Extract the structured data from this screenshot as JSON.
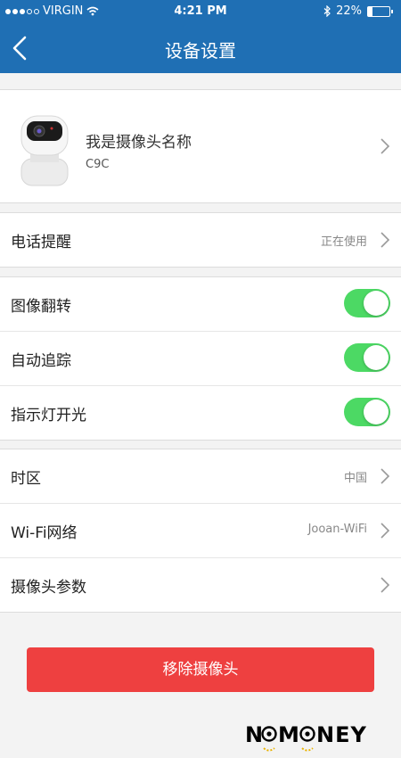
{
  "status_bar": {
    "carrier": "VIRGIN",
    "time": "4:21 PM",
    "battery": "22%",
    "battery_level": 0.22
  },
  "header": {
    "title": "设备设置"
  },
  "device": {
    "name": "我是摄像头名称",
    "model": "C9C"
  },
  "phone_alert": {
    "label": "电话提醒",
    "value": "正在使用"
  },
  "toggles": [
    {
      "label": "图像翻转",
      "on": true
    },
    {
      "label": "自动追踪",
      "on": true
    },
    {
      "label": "指示灯开光",
      "on": true
    }
  ],
  "settings": [
    {
      "label": "时区",
      "value": "中国"
    },
    {
      "label": "Wi-Fi网络",
      "value": "Jooan-WiFi"
    },
    {
      "label": "摄像头参数",
      "value": ""
    }
  ],
  "remove_button": "移除摄像头",
  "watermark": "NOMONEY",
  "colors": {
    "header": "#1f6fb4",
    "toggle_on": "#4cd964",
    "danger": "#ee4040"
  }
}
